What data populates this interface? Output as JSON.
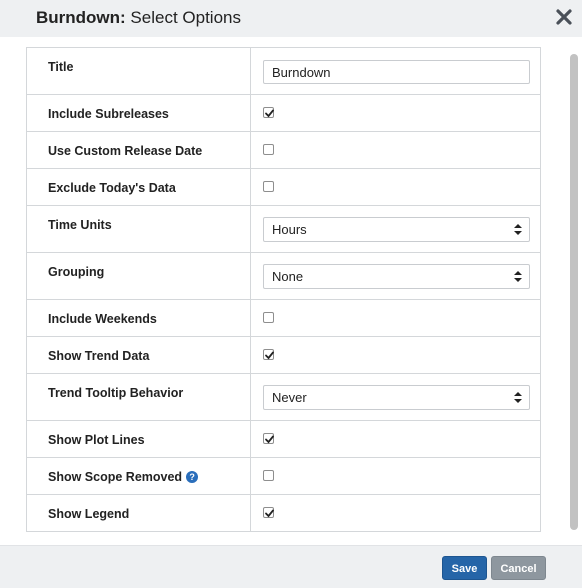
{
  "dialog": {
    "title_bold": "Burndown:",
    "title_rest": " Select Options",
    "close_icon": "close-x-icon"
  },
  "options": {
    "title": {
      "label": "Title",
      "value": "Burndown"
    },
    "include_subreleases": {
      "label": "Include Subreleases",
      "checked": true
    },
    "use_custom_release_date": {
      "label": "Use Custom Release Date",
      "checked": false
    },
    "exclude_todays_data": {
      "label": "Exclude Today's Data",
      "checked": false
    },
    "time_units": {
      "label": "Time Units",
      "value": "Hours"
    },
    "grouping": {
      "label": "Grouping",
      "value": "None"
    },
    "include_weekends": {
      "label": "Include Weekends",
      "checked": false
    },
    "show_trend_data": {
      "label": "Show Trend Data",
      "checked": true
    },
    "trend_tooltip_behavior": {
      "label": "Trend Tooltip Behavior",
      "value": "Never"
    },
    "show_plot_lines": {
      "label": "Show Plot Lines",
      "checked": true
    },
    "show_scope_removed": {
      "label": "Show Scope Removed",
      "checked": false,
      "help_glyph": "?"
    },
    "show_legend": {
      "label": "Show Legend",
      "checked": true
    }
  },
  "footer": {
    "save_label": "Save",
    "cancel_label": "Cancel"
  },
  "colors": {
    "primary_button": "#2565a8",
    "secondary_button": "#8e979f",
    "help_icon": "#2a6ebb",
    "header_bg": "#eef0f2"
  }
}
